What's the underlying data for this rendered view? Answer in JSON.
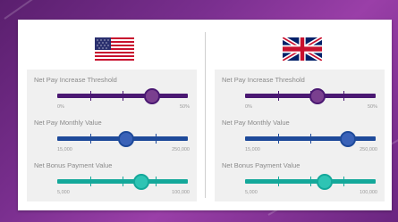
{
  "colors": {
    "purple": "#4a1872",
    "purple_knob": "#7a3f8f",
    "blue": "#1e4a9a",
    "blue_knob": "#3a62b8",
    "teal": "#14a89a",
    "teal_knob": "#2ec4b4"
  },
  "panels": [
    {
      "flag": "us-flag-icon",
      "controls": [
        {
          "label": "Net Pay Increase Threshold",
          "min": "0%",
          "max": "50%",
          "value_fraction": 0.72,
          "color": "purple"
        },
        {
          "label": "Net Pay Monthly Value",
          "min": "15,000",
          "max": "250,000",
          "value_fraction": 0.52,
          "color": "blue"
        },
        {
          "label": "Net Bonus Payment Value",
          "min": "5,000",
          "max": "100,000",
          "value_fraction": 0.64,
          "color": "teal"
        }
      ]
    },
    {
      "flag": "uk-flag-icon",
      "controls": [
        {
          "label": "Net Pay Increase Threshold",
          "min": "0%",
          "max": "50%",
          "value_fraction": 0.55,
          "color": "purple"
        },
        {
          "label": "Net Pay Monthly Value",
          "min": "15,000",
          "max": "250,000",
          "value_fraction": 0.78,
          "color": "blue"
        },
        {
          "label": "Net Bonus Payment Value",
          "min": "5,000",
          "max": "100,000",
          "value_fraction": 0.6,
          "color": "teal"
        }
      ]
    }
  ]
}
